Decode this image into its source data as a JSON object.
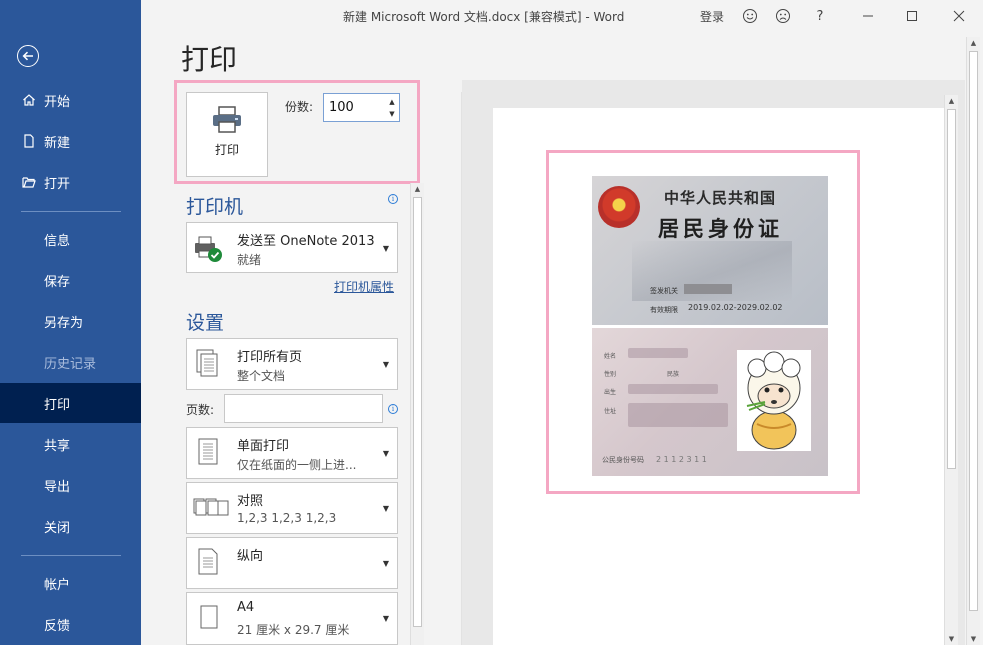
{
  "window": {
    "title": "新建 Microsoft Word 文档.docx [兼容模式]  -  Word",
    "login": "登录",
    "help": "?"
  },
  "nav": {
    "items": [
      {
        "label": "开始"
      },
      {
        "label": "新建"
      },
      {
        "label": "打开"
      },
      {
        "label": "信息"
      },
      {
        "label": "保存"
      },
      {
        "label": "另存为"
      },
      {
        "label": "历史记录"
      },
      {
        "label": "打印"
      },
      {
        "label": "共享"
      },
      {
        "label": "导出"
      },
      {
        "label": "关闭"
      },
      {
        "label": "帐户"
      },
      {
        "label": "反馈"
      }
    ]
  },
  "print": {
    "page_title": "打印",
    "print_button": "打印",
    "copies_label": "份数:",
    "copies_value": "100",
    "printer_heading": "打印机",
    "printer_name": "发送至 OneNote 2013",
    "printer_status": "就绪",
    "printer_properties": "打印机属性",
    "settings_heading": "设置",
    "pages_label": "页数:",
    "settings": [
      {
        "main": "打印所有页",
        "sub": "整个文档"
      },
      {
        "main": "单面打印",
        "sub": "仅在纸面的一侧上进..."
      },
      {
        "main": "对照",
        "sub": "1,2,3     1,2,3     1,2,3"
      },
      {
        "main": "纵向",
        "sub": ""
      },
      {
        "main": "A4",
        "sub": "21 厘米 x 29.7 厘米"
      }
    ]
  },
  "preview": {
    "card_front": {
      "line1": "中华人民共和国",
      "line2": "居民身份证",
      "issuer_label": "签发机关",
      "validity_label": "有效期限",
      "validity_value": "2019.02.02-2029.02.02"
    },
    "card_back": {
      "name_label": "姓名",
      "sex_label": "性别",
      "ethnicity_label": "民族",
      "birth_label": "出生",
      "address_label": "住址",
      "id_label": "公民身份号码",
      "id_value": "2 1 1 2 3        1 1"
    }
  },
  "colors": {
    "nav_bg": "#2b579a",
    "nav_active": "#002050",
    "accent": "#2b579a",
    "highlight": "#f4a7c3"
  }
}
